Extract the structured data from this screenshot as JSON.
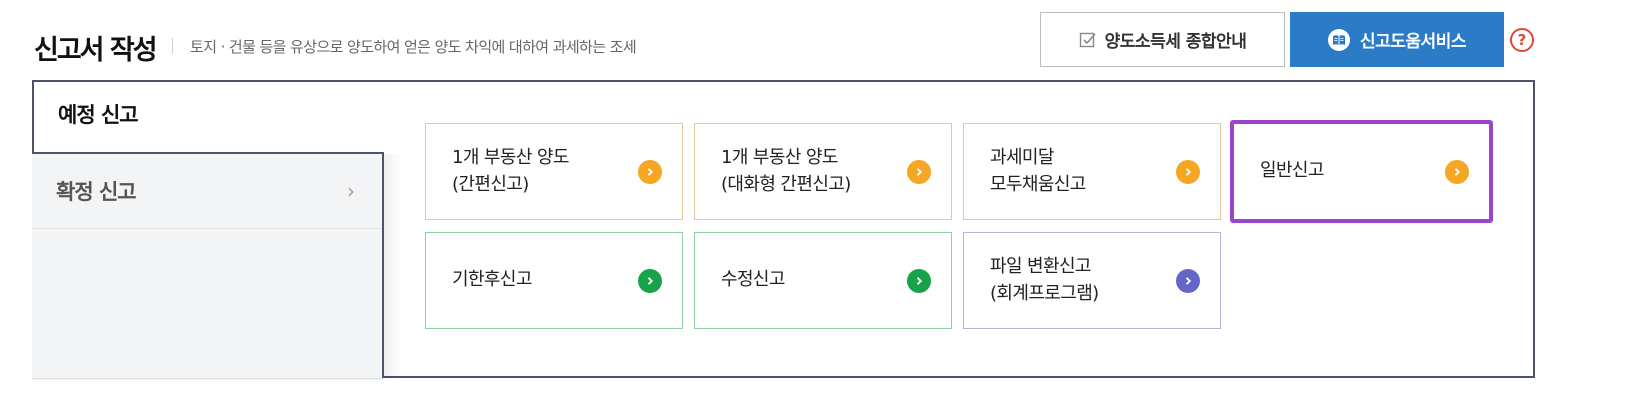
{
  "header": {
    "title": "신고서 작성",
    "subtitle": "토지 · 건물 등을 유상으로 양도하여 얻은 양도 차익에 대하여 과세하는 조세",
    "guide_button": "양도소득세 종합안내",
    "guide_icon": "checkbox-edit-icon",
    "help_service_button": "신고도움서비스",
    "help_service_icon": "book-icon",
    "question_icon": "question-circle-icon",
    "question_glyph": "?",
    "accent_color": "#2b7bc7"
  },
  "tabs": [
    {
      "label": "예정 신고",
      "active": true
    },
    {
      "label": "확정 신고",
      "active": false,
      "chevron": "›"
    }
  ],
  "cards": [
    {
      "label": "1개 부동산 양도\n(간편신고)",
      "color": "orange",
      "highlight": false
    },
    {
      "label": "1개 부동산 양도\n(대화형 간편신고)",
      "color": "orange",
      "highlight": false
    },
    {
      "label": "과세미달\n모두채움신고",
      "color": "orange",
      "highlight": false
    },
    {
      "label": "일반신고",
      "color": "orange",
      "highlight": true
    },
    {
      "label": "기한후신고",
      "color": "green",
      "highlight": false
    },
    {
      "label": "수정신고",
      "color": "green",
      "highlight": false
    },
    {
      "label": "파일 변환신고\n(회계프로그램)",
      "color": "purple",
      "highlight": false
    }
  ],
  "colors": {
    "orange": "#f5a623",
    "green": "#16a34a",
    "purple": "#6366c7",
    "highlight": "#9b44cc"
  }
}
